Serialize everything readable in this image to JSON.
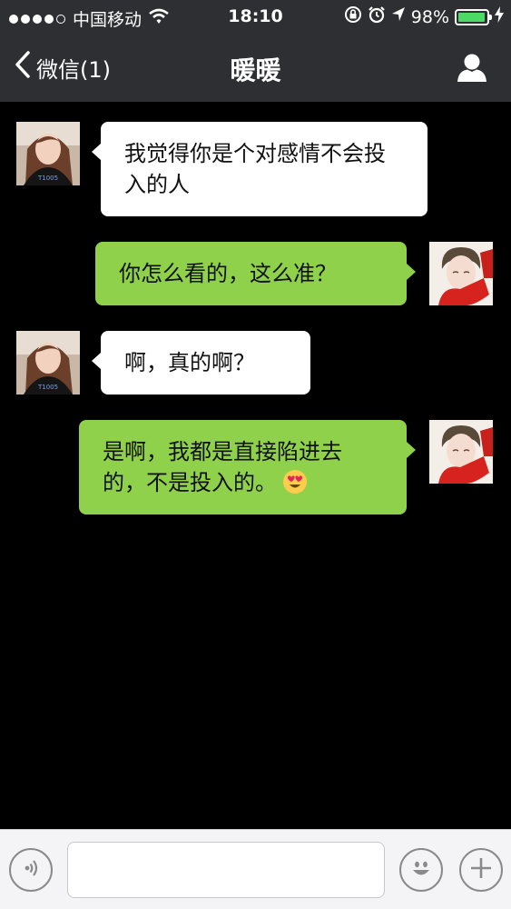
{
  "status_bar": {
    "carrier": "中国移动",
    "time": "18:10",
    "battery_percent": "98%",
    "battery_level": 0.98,
    "signal_bars_filled": 4,
    "signal_bars_total": 5,
    "icons": [
      "wifi-icon",
      "rotation-lock-icon",
      "alarm-icon",
      "location-icon",
      "battery-icon",
      "charging-icon"
    ]
  },
  "nav": {
    "back_label": "微信(1)",
    "title": "暖暖",
    "back_icon": "chevron-left-icon",
    "profile_icon": "person-icon"
  },
  "messages": [
    {
      "side": "in",
      "sender_avatar": "female-avatar",
      "text": "我觉得你是个对感情不会投入的人"
    },
    {
      "side": "out",
      "sender_avatar": "male-avatar",
      "text": "你怎么看的，这么准？"
    },
    {
      "side": "in",
      "sender_avatar": "female-avatar",
      "text": "啊，真的啊？"
    },
    {
      "side": "out",
      "sender_avatar": "male-avatar",
      "text": "是啊，我都是直接陷进去的，不是投入的。",
      "emoji": "heart-eyes-emoji"
    }
  ],
  "input_bar": {
    "voice_icon": "voice-icon",
    "emoji_icon": "smiley-icon",
    "add_icon": "plus-icon",
    "input_value": ""
  },
  "colors": {
    "bar_background": "#2e2f33",
    "chat_background": "#000000",
    "incoming_bubble": "#ffffff",
    "outgoing_bubble": "#8fd14b",
    "battery_fill": "#4cd964"
  }
}
